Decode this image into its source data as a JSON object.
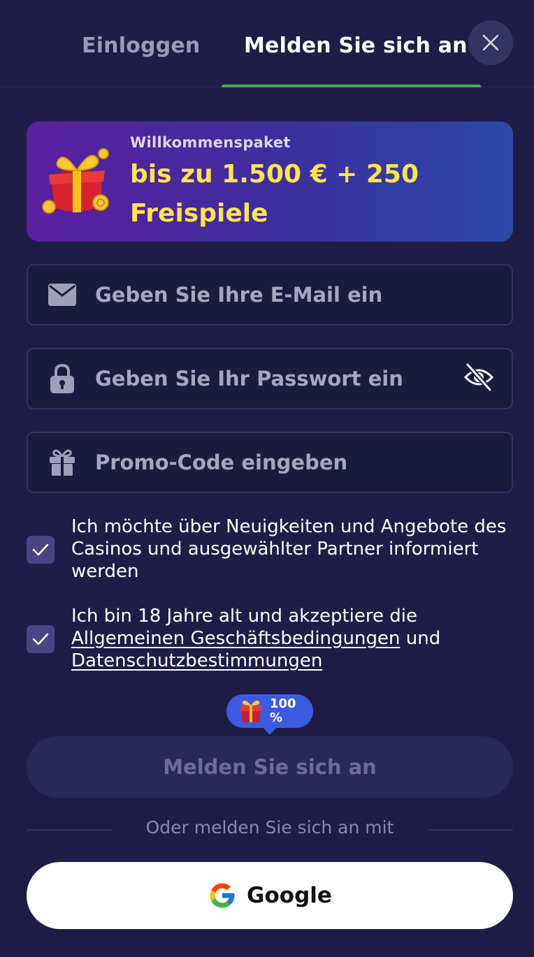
{
  "tabs": [
    {
      "label": "Einloggen",
      "active": false
    },
    {
      "label": "Melden Sie sich an",
      "active": true
    }
  ],
  "close_icon": "close-icon",
  "banner": {
    "subtitle": "Willkommenspaket",
    "title": "bis zu 1.500 € + 250 Freispiele",
    "icon": "gift-icon"
  },
  "form": {
    "email": {
      "placeholder": "Geben Sie Ihre E-Mail ein",
      "value": "",
      "icon": "envelope-icon"
    },
    "password": {
      "placeholder": "Geben Sie Ihr Passwort ein",
      "value": "",
      "icon": "lock-icon",
      "toggle_icon": "eye-off-icon"
    },
    "promo": {
      "placeholder": "Promo-Code eingeben",
      "value": "",
      "icon": "gift-icon"
    }
  },
  "consents": {
    "newsletter": {
      "checked": true,
      "text": "Ich möchte über Neuigkeiten und Angebote des Casinos und ausgewählter Partner informiert werden"
    },
    "terms": {
      "checked": true,
      "text_before": "Ich bin 18 Jahre alt und akzeptiere die ",
      "link_terms": "Allgemeinen Geschäftsbedingungen",
      "text_middle": " und ",
      "link_privacy": "Datenschutzbestimmungen"
    }
  },
  "bonus_tooltip": {
    "value": "100 %"
  },
  "submit_label": "Melden Sie sich an",
  "divider_text": "Oder melden Sie sich an mit",
  "google": {
    "label": "Google",
    "icon": "google-icon"
  },
  "colors": {
    "background": "#1f1d47",
    "accent_green": "#3fb54a",
    "banner_text": "#ffe34d",
    "tooltip": "#3d5be0"
  }
}
